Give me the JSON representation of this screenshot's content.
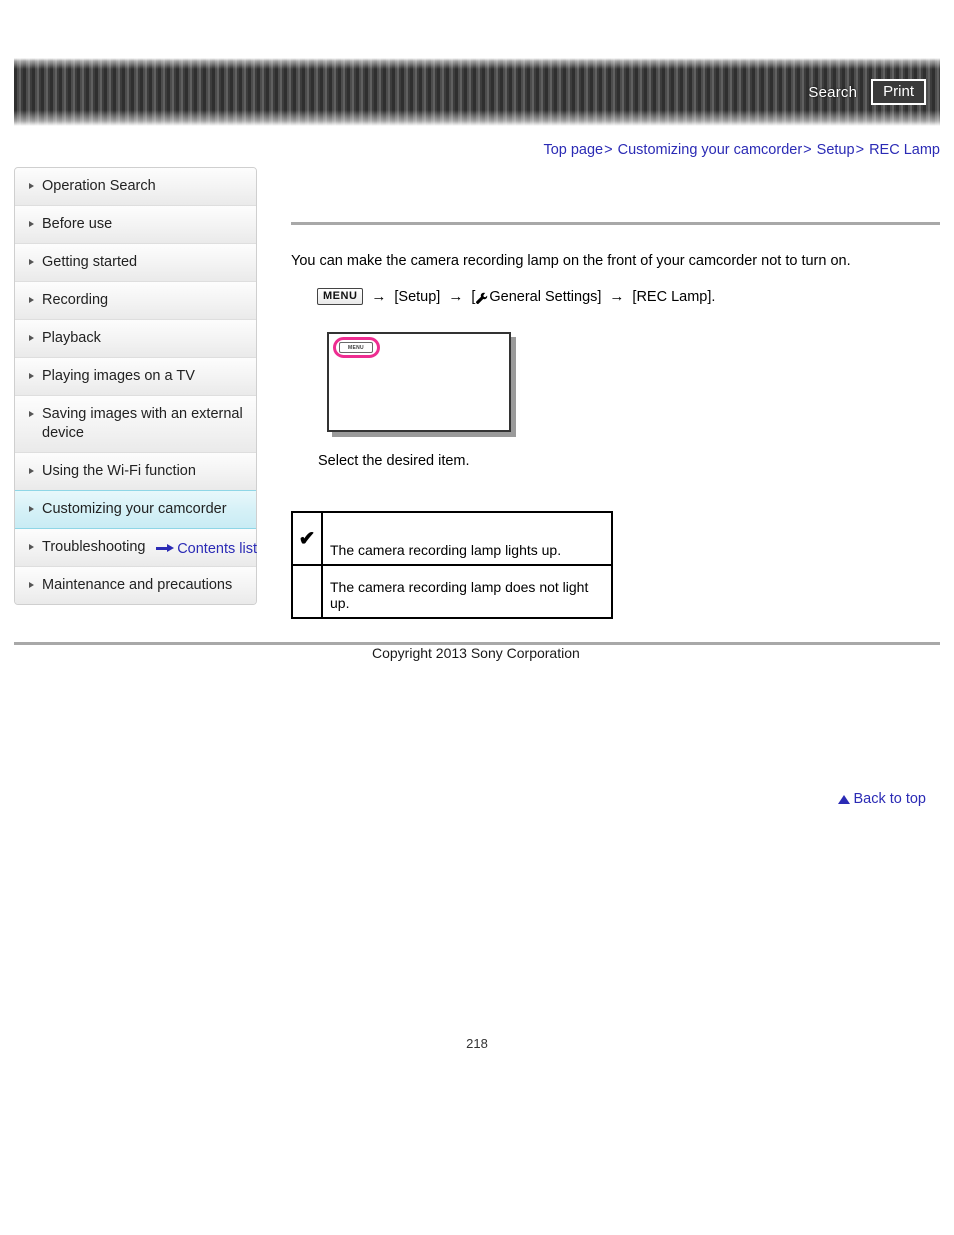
{
  "header": {
    "search_label": "Search",
    "print_label": "Print",
    "search_icon": "search-icon",
    "print_icon": "print-icon"
  },
  "breadcrumb": {
    "separator": ">",
    "items": [
      {
        "label": "Top page"
      },
      {
        "label": "Customizing your camcorder"
      },
      {
        "label": "Setup"
      },
      {
        "label": "REC Lamp"
      }
    ]
  },
  "sidebar": {
    "items": [
      {
        "label": "Operation Search",
        "active": false
      },
      {
        "label": "Before use",
        "active": false
      },
      {
        "label": "Getting started",
        "active": false
      },
      {
        "label": "Recording",
        "active": false
      },
      {
        "label": "Playback",
        "active": false
      },
      {
        "label": "Playing images on a TV",
        "active": false
      },
      {
        "label": "Saving images with an external device",
        "active": false
      },
      {
        "label": "Using the Wi-Fi function",
        "active": false
      },
      {
        "label": "Customizing your camcorder",
        "active": true
      },
      {
        "label": "Troubleshooting",
        "active": false
      },
      {
        "label": "Maintenance and precautions",
        "active": false
      }
    ],
    "contents_list_label": "Contents list",
    "contents_list_icon": "arrow-right-icon"
  },
  "main": {
    "intro": "You can make the camera recording lamp on the front of your camcorder not to turn on.",
    "menu_path": {
      "menu_chip_label": "MENU",
      "arrow": "→",
      "step1": "[Setup]",
      "wrench_icon": "wrench-icon",
      "step2_open": "[",
      "step2": "General Settings]",
      "step3": "[REC Lamp]."
    },
    "illustration": {
      "menu_button_label": "MENU",
      "highlight_color": "#ee2d91"
    },
    "select_text": "Select the desired item.",
    "options_table": {
      "rows": [
        {
          "checked": true,
          "check_glyph": "✔",
          "label": "The camera recording lamp lights up."
        },
        {
          "checked": false,
          "check_glyph": "",
          "label": "The camera recording lamp does not light up."
        }
      ]
    }
  },
  "footer": {
    "back_to_top_label": "Back to top",
    "back_to_top_icon": "arrow-up-icon",
    "copyright": "Copyright 2013 Sony Corporation",
    "page_number": "218"
  }
}
